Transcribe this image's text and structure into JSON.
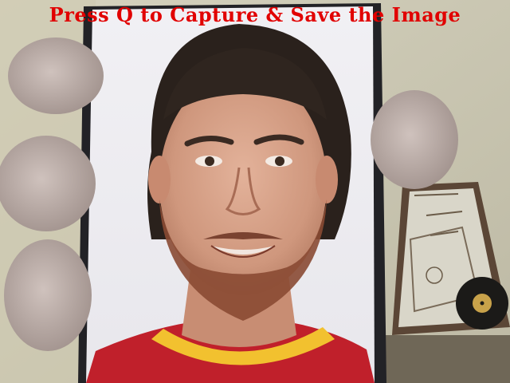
{
  "camera_view": {
    "overlay_instruction": "Press Q to Capture & Save the Image",
    "overlay_color": "#e10000",
    "shortcut_key": "Q",
    "background_frame_sketch": [
      "sketch-text-line",
      "sketch-text-line",
      "sketch-text-line"
    ],
    "icons": {
      "record": "vinyl-record-icon"
    }
  }
}
